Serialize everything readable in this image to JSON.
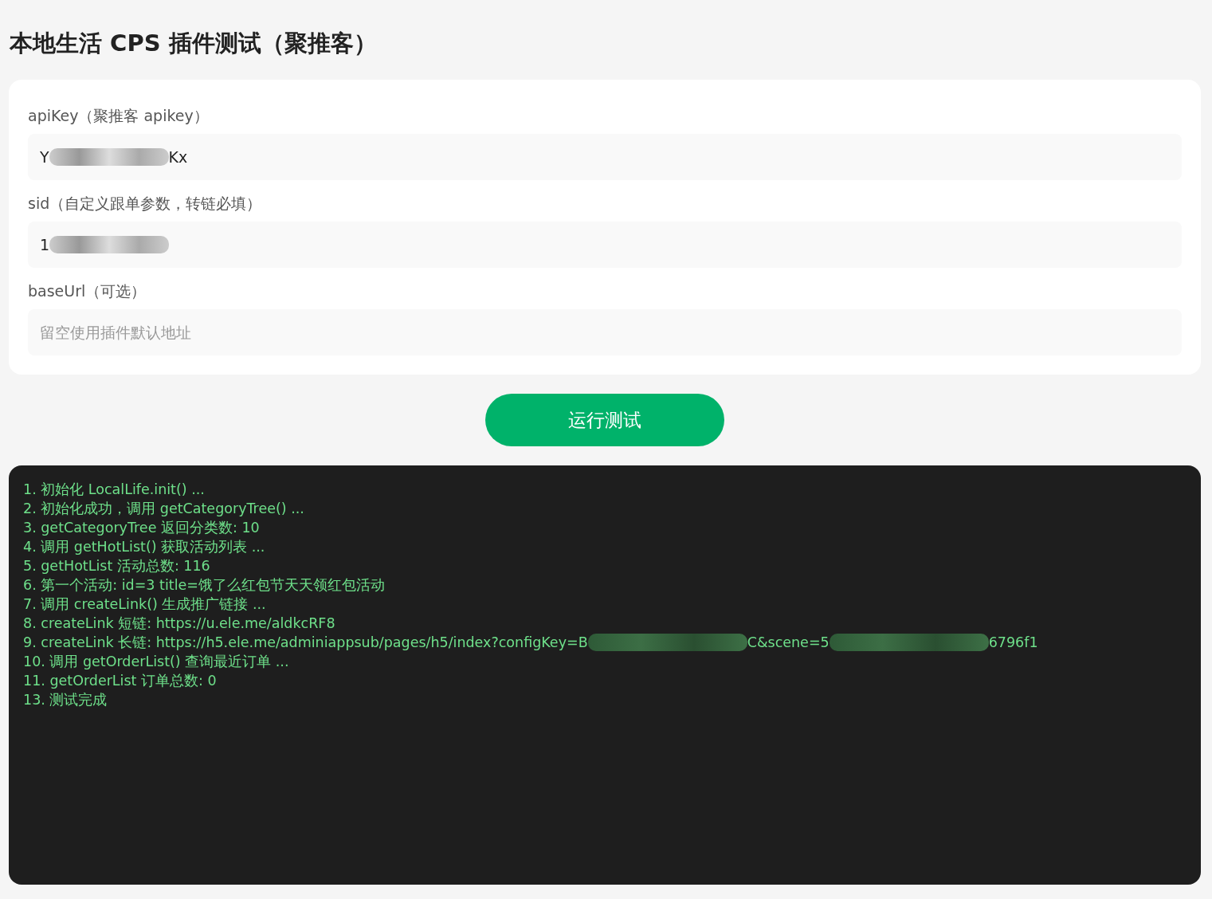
{
  "title": "本地生活 CPS 插件测试（聚推客）",
  "fields": [
    {
      "label": "apiKey（聚推客 apikey）",
      "parts": [
        {
          "kind": "text",
          "text": "Y"
        },
        {
          "kind": "redacted"
        },
        {
          "kind": "text",
          "text": "Kx"
        }
      ]
    },
    {
      "label": "sid（自定义跟单参数，转链必填）",
      "parts": [
        {
          "kind": "text",
          "text": "1"
        },
        {
          "kind": "redacted"
        }
      ]
    },
    {
      "label": "baseUrl（可选）",
      "placeholder": "留空使用插件默认地址"
    }
  ],
  "run_button": "运行测试",
  "log": [
    {
      "parts": [
        {
          "kind": "text",
          "text": "1. 初始化 LocalLife.init() ..."
        }
      ]
    },
    {
      "parts": [
        {
          "kind": "text",
          "text": "2. 初始化成功，调用 getCategoryTree() ..."
        }
      ]
    },
    {
      "parts": [
        {
          "kind": "text",
          "text": "3. getCategoryTree 返回分类数: 10"
        }
      ]
    },
    {
      "parts": [
        {
          "kind": "text",
          "text": "4. 调用 getHotList() 获取活动列表 ..."
        }
      ]
    },
    {
      "parts": [
        {
          "kind": "text",
          "text": "5. getHotList 活动总数: 116"
        }
      ]
    },
    {
      "parts": [
        {
          "kind": "text",
          "text": "6. 第一个活动: id=3 title=饿了么红包节天天领红包活动"
        }
      ]
    },
    {
      "parts": [
        {
          "kind": "text",
          "text": "7. 调用 createLink() 生成推广链接 ..."
        }
      ]
    },
    {
      "parts": [
        {
          "kind": "text",
          "text": "8. createLink 短链: https://u.ele.me/aldkcRF8"
        }
      ]
    },
    {
      "parts": [
        {
          "kind": "text",
          "text": "9. createLink 长链: https://h5.ele.me/adminiappsub/pages/h5/index?configKey=B"
        },
        {
          "kind": "redacted"
        },
        {
          "kind": "text",
          "text": "C&scene=5"
        },
        {
          "kind": "redacted"
        },
        {
          "kind": "text",
          "text": "6796f1"
        }
      ]
    },
    {
      "parts": [
        {
          "kind": "text",
          "text": "10. 调用 getOrderList() 查询最近订单 ..."
        }
      ]
    },
    {
      "parts": [
        {
          "kind": "text",
          "text": "11. getOrderList 订单总数: 0"
        }
      ]
    },
    {
      "parts": [
        {
          "kind": "text",
          "text": "13. 测试完成"
        }
      ]
    }
  ]
}
